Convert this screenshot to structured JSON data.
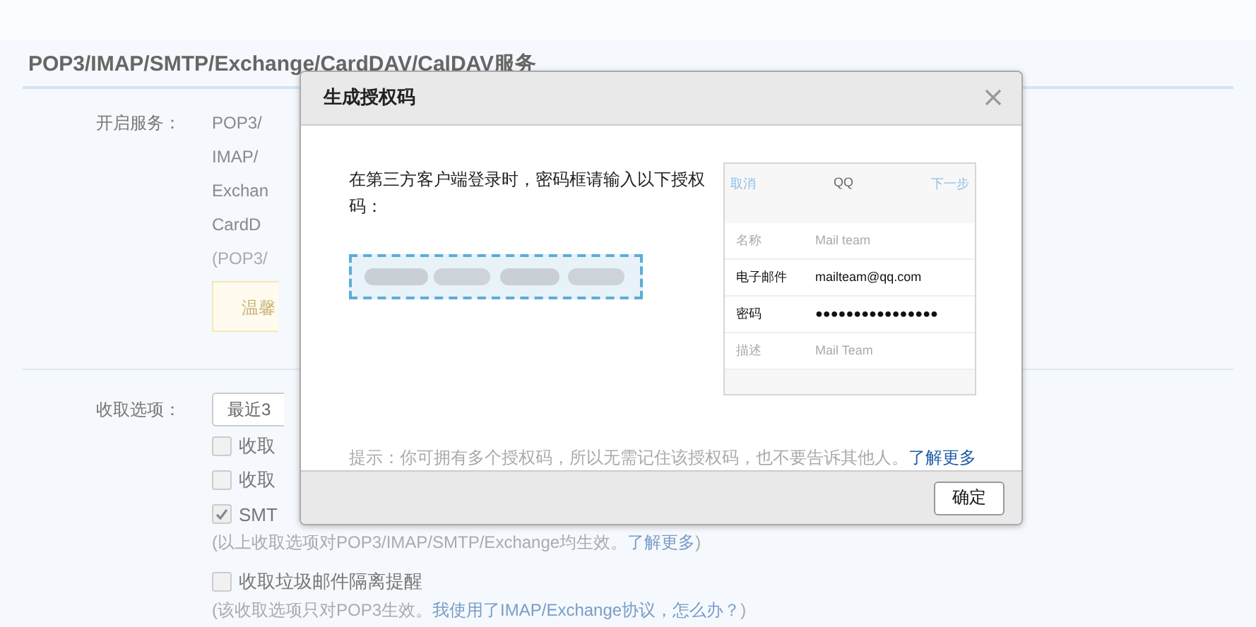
{
  "page": {
    "title": "POP3/IMAP/SMTP/Exchange/CardDAV/CalDAV服务",
    "services": {
      "label": "开启服务：",
      "items": [
        "POP3/",
        "IMAP/",
        "Exchan",
        "CardD"
      ],
      "note": "(POP3/",
      "tip": "温馨"
    },
    "receive": {
      "label": "收取选项：",
      "dropdown": "最近3",
      "options": [
        {
          "text": "收取",
          "checked": false
        },
        {
          "text": "收取",
          "checked": false
        },
        {
          "text": "SMT",
          "checked": true
        }
      ],
      "note": "(以上收取选项对POP3/IMAP/SMTP/Exchange均生效。",
      "note_link": "了解更多",
      "note_end": ")",
      "spam_option": {
        "text": "收取垃圾邮件隔离提醒",
        "checked": false
      },
      "spam_note": "(该收取选项只对POP3生效。",
      "spam_note_link": "我使用了IMAP/Exchange协议，怎么办？",
      "spam_note_end": ")"
    }
  },
  "dialog": {
    "title": "生成授权码",
    "instruction": "在第三方客户端登录时，密码框请输入以下授权码：",
    "preview": {
      "cancel": "取消",
      "title": "QQ",
      "next": "下一步",
      "rows": [
        {
          "label": "名称",
          "value": "Mail team",
          "kind": "placeholder"
        },
        {
          "label": "电子邮件",
          "value": "mailteam@qq.com",
          "kind": "filled"
        },
        {
          "label": "密码",
          "value": "●●●●●●●●●●●●●●●●",
          "kind": "filled"
        },
        {
          "label": "描述",
          "value": "Mail Team",
          "kind": "placeholder"
        }
      ]
    },
    "hint": "提示：你可拥有多个授权码，所以无需记住该授权码，也不要告诉其他人。",
    "hint_link": "了解更多",
    "button": "确定"
  }
}
